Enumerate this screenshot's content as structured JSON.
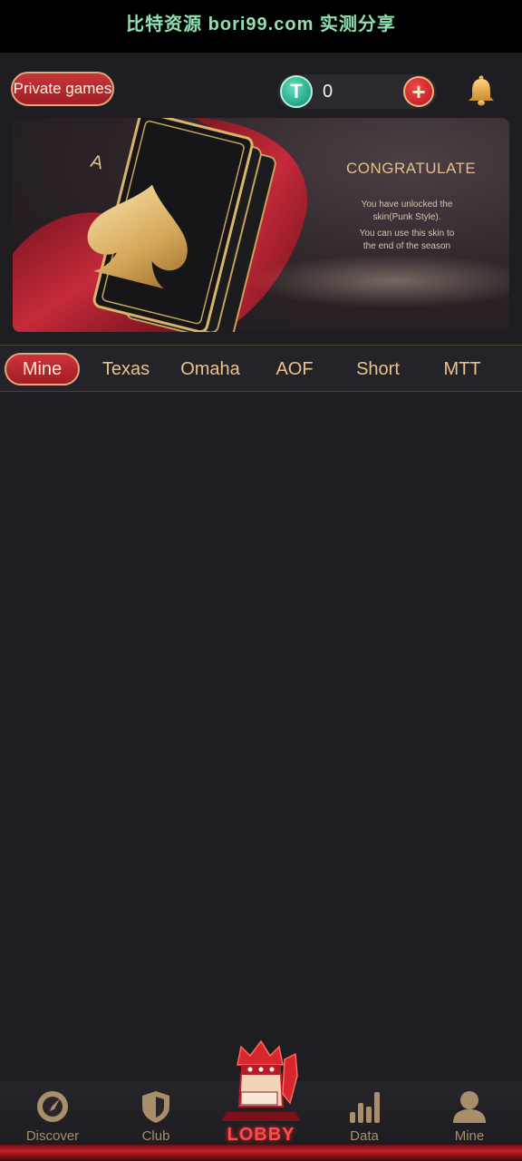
{
  "watermark": "比特资源 bori99.com 实测分享",
  "header": {
    "private_games_label": "Private games",
    "balance": "0",
    "coin_icon_glyph": "T",
    "add_glyph": "+"
  },
  "banner": {
    "title": "CONGRATULATE",
    "line1": "You have unlocked the",
    "line2": "skin(Punk Style).",
    "line3": "You can use this skin to",
    "line4": "the end of the season",
    "card_rank": "A"
  },
  "tabs": [
    {
      "label": "Mine",
      "active": true
    },
    {
      "label": "Texas",
      "active": false
    },
    {
      "label": "Omaha",
      "active": false
    },
    {
      "label": "AOF",
      "active": false
    },
    {
      "label": "Short",
      "active": false
    },
    {
      "label": "MTT",
      "active": false
    }
  ],
  "bottom_nav": {
    "discover": "Discover",
    "club": "Club",
    "lobby": "LOBBY",
    "data": "Data",
    "mine": "Mine"
  },
  "colors": {
    "accent_gold": "#e8c48a",
    "accent_red": "#c8353c",
    "background": "#1e1e22"
  }
}
